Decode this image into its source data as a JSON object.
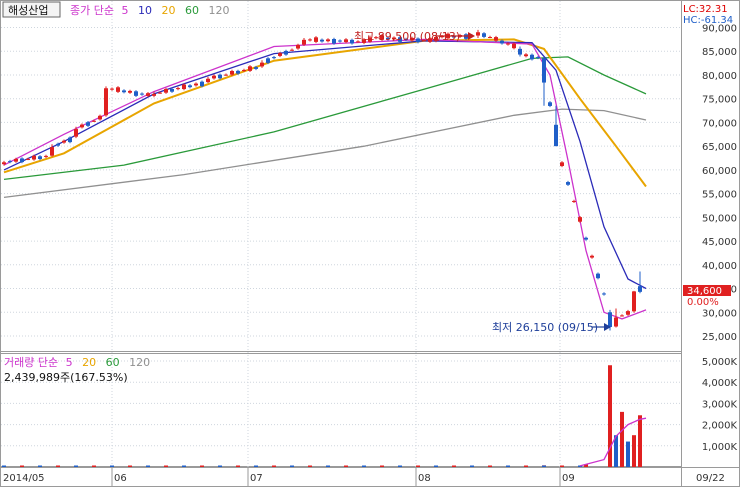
{
  "stock_name": "해성산업",
  "price_legend": {
    "prefix": "종가 단순",
    "ma": [
      "5",
      "10",
      "20",
      "60",
      "120"
    ]
  },
  "volume_legend": {
    "prefix": "거래량 단순",
    "ma": [
      "5",
      "20",
      "60",
      "120"
    ]
  },
  "volume_summary": "2,439,989주(167.53%)",
  "lc_label": "LC:32.31",
  "hc_label": "HC:-61.34",
  "current_price_label": "34,600",
  "current_change_label": "0.00%",
  "annotations": {
    "high": "최고 89,500 (08/13)",
    "low": "최저 26,150 (09/15)"
  },
  "price_ticks": [
    "90,000",
    "85,000",
    "80,000",
    "75,000",
    "70,000",
    "65,000",
    "60,000",
    "55,000",
    "50,000",
    "45,000",
    "40,000",
    "35,000",
    "30,000",
    "25,000"
  ],
  "volume_ticks": [
    "5,000K",
    "4,000K",
    "3,000K",
    "2,000K",
    "1,000K"
  ],
  "x_ticks": [
    "2014/05",
    "06",
    "07",
    "08",
    "09",
    "09/22"
  ],
  "colors": {
    "up": "#e02020",
    "down": "#1f5fc8",
    "ma5": "#cc33cc",
    "ma10": "#2b2bb8",
    "ma20": "#e8a500",
    "ma60": "#2a9a3a",
    "ma120": "#909090",
    "vol_ma5": "#cc33cc"
  },
  "chart_data": {
    "type": "candlestick",
    "title": "해성산업",
    "x_range": [
      "2014/05",
      "09/22"
    ],
    "y_range_price": [
      21500,
      92500
    ],
    "y_range_volume": [
      0,
      5400000
    ],
    "grid": true,
    "candles_sampled": [
      {
        "i": 0,
        "o": 61200,
        "c": 61600,
        "h": 61900,
        "l": 60900
      },
      {
        "i": 8,
        "o": 63000,
        "c": 64800,
        "h": 65400,
        "l": 62800
      },
      {
        "i": 12,
        "o": 67000,
        "c": 68600,
        "h": 69100,
        "l": 66700
      },
      {
        "i": 17,
        "o": 71500,
        "c": 77200,
        "h": 77600,
        "l": 71200
      },
      {
        "i": 25,
        "o": 75600,
        "c": 76000,
        "h": 76500,
        "l": 75300
      },
      {
        "i": 34,
        "o": 78500,
        "c": 79200,
        "h": 79600,
        "l": 78300
      },
      {
        "i": 43,
        "o": 81800,
        "c": 82600,
        "h": 83100,
        "l": 81500
      },
      {
        "i": 50,
        "o": 86400,
        "c": 87400,
        "h": 87800,
        "l": 86100
      },
      {
        "i": 61,
        "o": 87000,
        "c": 87900,
        "h": 88300,
        "l": 86800
      },
      {
        "i": 72,
        "o": 87200,
        "c": 88000,
        "h": 88400,
        "l": 86900
      },
      {
        "i": 79,
        "o": 88300,
        "c": 89000,
        "h": 89500,
        "l": 87800
      },
      {
        "i": 86,
        "o": 85500,
        "c": 84300,
        "h": 86000,
        "l": 83900
      },
      {
        "i": 90,
        "o": 83500,
        "c": 78400,
        "h": 83800,
        "l": 73500
      },
      {
        "i": 92,
        "o": 69500,
        "c": 65000,
        "h": 73500,
        "l": 65000
      },
      {
        "i": 101,
        "o": 30000,
        "c": 26900,
        "h": 30500,
        "l": 26150
      },
      {
        "i": 102,
        "o": 27000,
        "c": 28900,
        "h": 30800,
        "l": 26800
      },
      {
        "i": 105,
        "o": 30200,
        "c": 34400,
        "h": 34500,
        "l": 29900
      },
      {
        "i": 106,
        "o": 35500,
        "c": 34300,
        "h": 38600,
        "l": 34000
      }
    ],
    "volume_sampled": [
      {
        "i": 0,
        "v": 0
      },
      {
        "i": 30,
        "v": 40000
      },
      {
        "i": 60,
        "v": 30000
      },
      {
        "i": 90,
        "v": 80000
      },
      {
        "i": 97,
        "v": 120000
      },
      {
        "i": 101,
        "v": 4800000
      },
      {
        "i": 102,
        "v": 1500000
      },
      {
        "i": 103,
        "v": 2600000
      },
      {
        "i": 104,
        "v": 1200000
      },
      {
        "i": 105,
        "v": 1500000
      },
      {
        "i": 106,
        "v": 2440000
      }
    ],
    "ma_levels_last": {
      "ma5": 30500,
      "ma10": 35000,
      "ma20": 56500,
      "ma60": 76000,
      "ma120": 70500
    },
    "high": {
      "value": 89500,
      "date": "08/13"
    },
    "low": {
      "value": 26150,
      "date": "09/15"
    },
    "last_close": 34600
  }
}
